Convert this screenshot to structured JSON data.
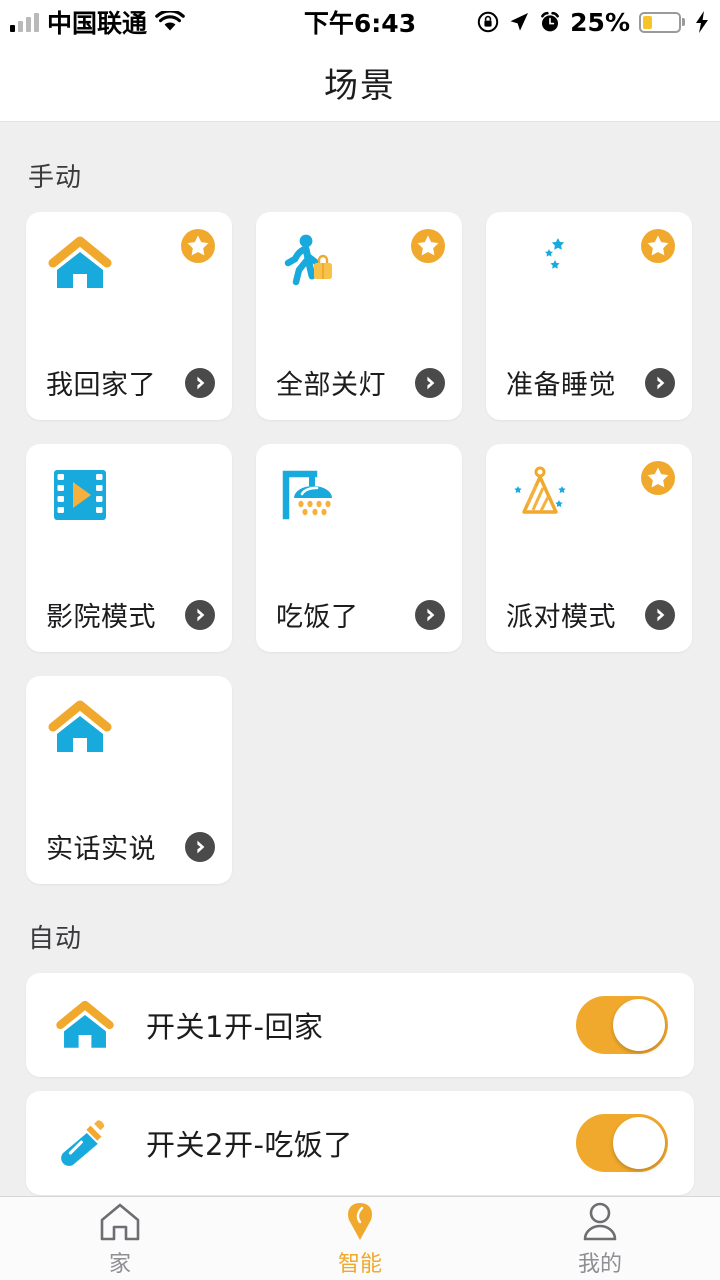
{
  "status_bar": {
    "carrier": "中国联通",
    "wifi_icon": "wifi-icon",
    "signal_icon": "signal-bars-icon",
    "time": "下午6:43",
    "rotation_lock_icon": "rotation-lock-icon",
    "location_icon": "location-arrow-icon",
    "alarm_icon": "alarm-clock-icon",
    "battery_percent": "25%",
    "battery_level": 25,
    "battery_color": "#f6c32b",
    "charging_icon": "lightning-bolt-icon"
  },
  "nav": {
    "title": "场景"
  },
  "theme": {
    "accent_orange": "#f0a92c",
    "accent_cyan": "#18a9dd",
    "page_background": "#efeff0",
    "card_background": "#ffffff",
    "arrow_circle": "#4a4a4a"
  },
  "sections": {
    "manual_title": "手动",
    "auto_title": "自动"
  },
  "scenes": [
    {
      "label": "我回家了",
      "icon": "house-icon",
      "favorite": true,
      "arrow_icon": "chevron-right-circle-icon"
    },
    {
      "label": "全部关灯",
      "icon": "walking-person-with-suitcase-icon",
      "favorite": true,
      "arrow_icon": "chevron-right-circle-icon"
    },
    {
      "label": "准备睡觉",
      "icon": "crescent-moon-stars-icon",
      "favorite": true,
      "arrow_icon": "chevron-right-circle-icon"
    },
    {
      "label": "影院模式",
      "icon": "film-strip-play-icon",
      "favorite": false,
      "arrow_icon": "chevron-right-circle-icon"
    },
    {
      "label": "吃饭了",
      "icon": "shower-head-icon",
      "favorite": false,
      "arrow_icon": "chevron-right-circle-icon"
    },
    {
      "label": "派对模式",
      "icon": "party-hat-icon",
      "favorite": true,
      "arrow_icon": "chevron-right-circle-icon"
    },
    {
      "label": "实话实说",
      "icon": "house-icon",
      "favorite": false,
      "arrow_icon": "chevron-right-circle-icon"
    }
  ],
  "automations": [
    {
      "label": "开关1开-回家",
      "icon": "house-icon",
      "enabled": true
    },
    {
      "label": "开关2开-吃饭了",
      "icon": "baby-bottle-icon",
      "enabled": true
    }
  ],
  "tabs": [
    {
      "label": "家",
      "icon": "home-outline-icon",
      "active": false
    },
    {
      "label": "智能",
      "icon": "smart-pin-icon",
      "active": true
    },
    {
      "label": "我的",
      "icon": "person-outline-icon",
      "active": false
    }
  ]
}
